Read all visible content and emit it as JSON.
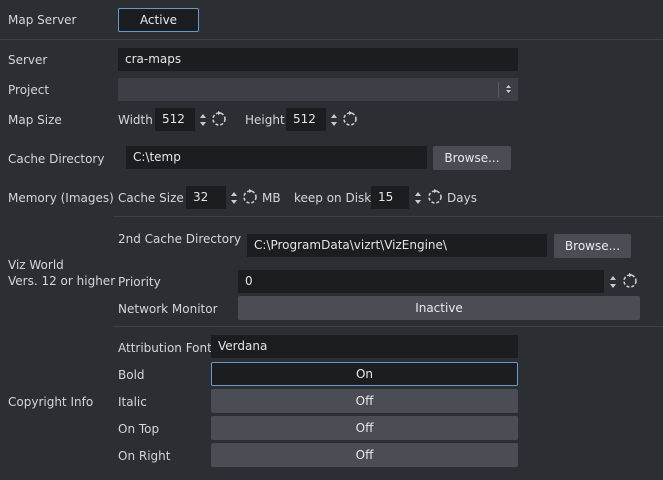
{
  "map_server": {
    "label": "Map Server",
    "state": "Active"
  },
  "server": {
    "label": "Server",
    "value": "cra-maps"
  },
  "project": {
    "label": "Project",
    "value": ""
  },
  "map_size": {
    "label": "Map Size",
    "width_label": "Width",
    "width_value": "512",
    "height_label": "Height",
    "height_value": "512"
  },
  "cache_directory": {
    "label": "Cache Directory",
    "value": "C:\\temp",
    "browse": "Browse..."
  },
  "memory": {
    "label": "Memory (Images)",
    "cache_size_label": "Cache Size",
    "cache_size_value": "32",
    "cache_size_unit": "MB",
    "keep_label": "keep on Disk",
    "keep_value": "15",
    "keep_unit": "Days"
  },
  "viz_world": {
    "label_line1": "Viz World",
    "label_line2": "Vers. 12 or higher",
    "second_cache_label": "2nd Cache Directory",
    "second_cache_value": "C:\\ProgramData\\vizrt\\VizEngine\\",
    "browse": "Browse...",
    "priority_label": "Priority",
    "priority_value": "0",
    "network_monitor_label": "Network Monitor",
    "network_monitor_state": "Inactive"
  },
  "copyright": {
    "label": "Copyright Info",
    "font_label": "Attribution Font",
    "font_value": "Verdana",
    "bold_label": "Bold",
    "bold_state": "On",
    "italic_label": "Italic",
    "italic_state": "Off",
    "ontop_label": "On Top",
    "ontop_state": "Off",
    "onright_label": "On Right",
    "onright_state": "Off"
  },
  "colors": {
    "background": "#2b2e32",
    "field": "#1b1d20",
    "button": "#4a4e54",
    "focus_border": "#6c98c8",
    "text": "#d4d6d9"
  },
  "icons": [
    "spin-arrows-icon",
    "reset-icon",
    "combo-arrow-icon"
  ]
}
